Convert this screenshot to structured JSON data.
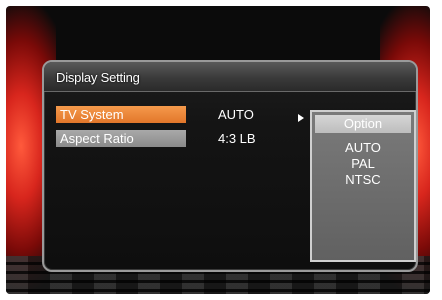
{
  "dialog": {
    "title": "Display Setting"
  },
  "settings": [
    {
      "label": "TV System",
      "value": "AUTO",
      "selected": true
    },
    {
      "label": "Aspect Ratio",
      "value": "4:3 LB",
      "selected": false
    }
  ],
  "option_panel": {
    "header": "Option",
    "items": [
      "AUTO",
      "PAL",
      "NTSC"
    ]
  },
  "colors": {
    "selected_row": "#e98236",
    "normal_row": "#9a9a9a",
    "side_glow": "#d8261d"
  }
}
